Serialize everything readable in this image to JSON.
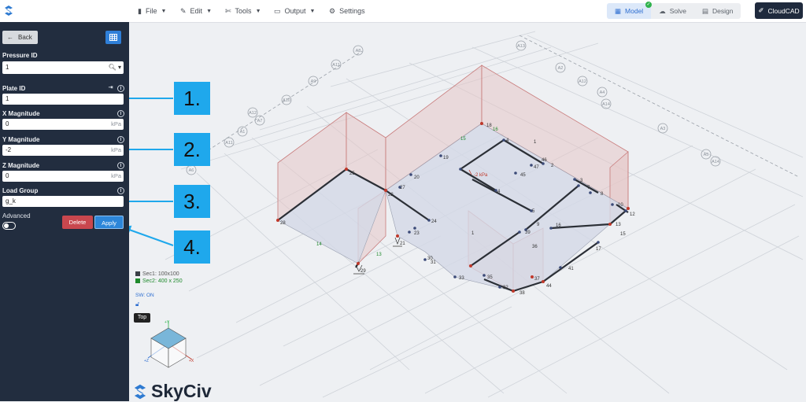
{
  "menu": {
    "file": "File",
    "edit": "Edit",
    "tools": "Tools",
    "output": "Output",
    "settings": "Settings"
  },
  "workflow": {
    "model": "Model",
    "solve": "Solve",
    "design": "Design"
  },
  "cloudcad": "CloudCAD",
  "sidebar": {
    "back": "Back",
    "pressure_id_label": "Pressure ID",
    "pressure_id_value": "1",
    "plate_id_label": "Plate ID",
    "plate_id_value": "1",
    "x_label": "X Magnitude",
    "x_value": "0",
    "y_label": "Y Magnitude",
    "y_value": "-2",
    "z_label": "Z Magnitude",
    "z_value": "0",
    "unit": "kPa",
    "load_group_label": "Load Group",
    "load_group_value": "g_k",
    "advanced_label": "Advanced",
    "advanced_on": false,
    "delete": "Delete",
    "apply": "Apply"
  },
  "callouts": [
    "1.",
    "2.",
    "3.",
    "4."
  ],
  "legend": {
    "sec1": "Sec1: 100x100",
    "sec2": "Sec2: 400 x 250",
    "sec1_color": "#3a3f46",
    "sec2_color": "#1f8a2c",
    "sw": "SW: ON"
  },
  "view_tag": "Top",
  "brand": "SkyCiv",
  "accent": "#2d86d9",
  "callout_color": "#1fa8ec",
  "model": {
    "grid_labels": [
      "A8",
      "A11",
      "A9",
      "A10",
      "A12",
      "A7",
      "A1",
      "A6",
      "A13",
      "A2",
      "A3",
      "A4",
      "A5",
      "A14"
    ],
    "node_labels": [
      "18",
      "16",
      "15",
      "19",
      "46",
      "45",
      "47",
      "2",
      "26",
      "27",
      "22",
      "25",
      "28",
      "24",
      "23",
      "21",
      "29",
      "30",
      "31",
      "33",
      "35",
      "32",
      "38",
      "44",
      "41",
      "17",
      "15",
      "13",
      "12",
      "10",
      "9",
      "7",
      "8",
      "39",
      "36",
      "37",
      "6",
      "5",
      "4",
      "3",
      "1",
      "14",
      "11"
    ],
    "pressure_label": "-2 kPa"
  }
}
